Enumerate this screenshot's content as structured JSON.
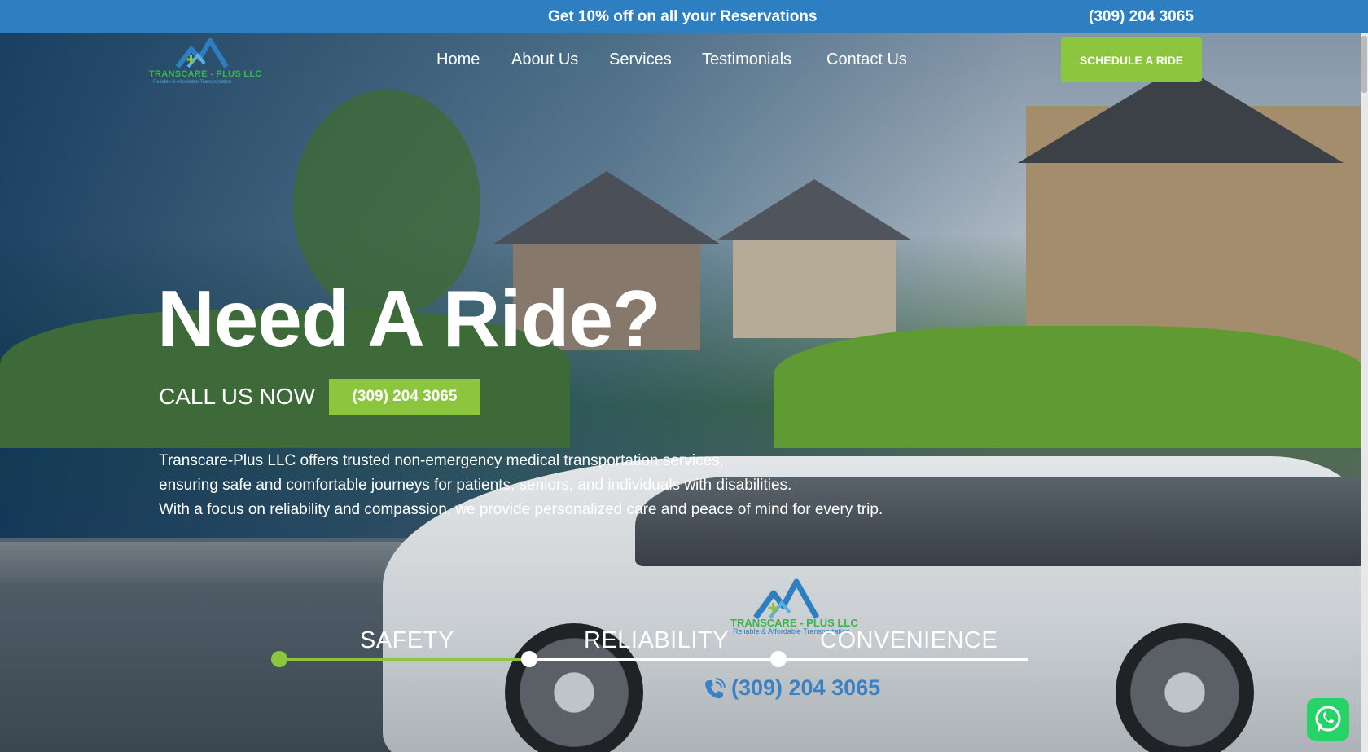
{
  "promo_bar": {
    "text": "Get 10% off on all your Reservations",
    "phone": "(309) 204 3065"
  },
  "logo": {
    "name": "TRANSCARE - PLUS LLC",
    "tagline": "Reliable & Affordable Transportation"
  },
  "nav": {
    "items": [
      "Home",
      "About Us",
      "Services",
      "Testimonials",
      "Contact Us"
    ],
    "cta": "SCHEDULE A RIDE"
  },
  "hero": {
    "headline": "Need A Ride?",
    "call_label": "CALL US NOW",
    "call_phone": "(309) 204 3065",
    "description": [
      "Transcare-Plus LLC offers trusted non-emergency medical transportation services,",
      "ensuring safe and comfortable journeys for patients, seniors, and individuals with disabilities.",
      "With a focus on reliability and compassion, we provide personalized care and peace of mind for every trip."
    ]
  },
  "van": {
    "logo_name": "TRANSCARE - PLUS LLC",
    "logo_tagline": "Reliable & Affordable Transportation",
    "phone": "(309) 204 3065"
  },
  "timeline": {
    "labels": [
      "SAFETY",
      "RELIABILITY",
      "CONVENIENCE"
    ]
  },
  "colors": {
    "top_bar": "#2e7fc1",
    "accent_green": "#8cc63f",
    "whatsapp": "#25d366"
  },
  "icons": {
    "whatsapp": "whatsapp-icon",
    "phone": "phone-icon"
  }
}
